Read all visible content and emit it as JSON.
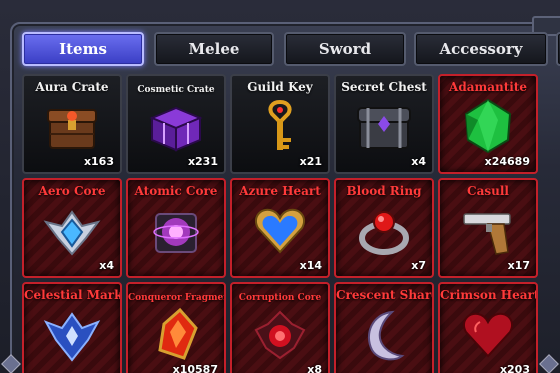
{
  "tabs": [
    {
      "label": "Items",
      "active": true
    },
    {
      "label": "Melee",
      "active": false
    },
    {
      "label": "Sword",
      "active": false
    },
    {
      "label": "Accessory",
      "active": false
    }
  ],
  "items": [
    {
      "name": "Aura Crate",
      "count": "x163",
      "rarity": "common",
      "icon": "aura-crate-icon"
    },
    {
      "name": "Cosmetic Crate",
      "count": "x231",
      "rarity": "common",
      "icon": "cosmetic-crate-icon"
    },
    {
      "name": "Guild Key",
      "count": "x21",
      "rarity": "common",
      "icon": "guild-key-icon"
    },
    {
      "name": "Secret Chest",
      "count": "x4",
      "rarity": "common",
      "icon": "secret-chest-icon"
    },
    {
      "name": "Adamantite",
      "count": "x24689",
      "rarity": "red",
      "icon": "adamantite-icon"
    },
    {
      "name": "Aero Core",
      "count": "x4",
      "rarity": "red",
      "icon": "aero-core-icon"
    },
    {
      "name": "Atomic Core",
      "count": "",
      "rarity": "red",
      "icon": "atomic-core-icon"
    },
    {
      "name": "Azure Heart",
      "count": "x14",
      "rarity": "red",
      "icon": "azure-heart-icon"
    },
    {
      "name": "Blood Ring",
      "count": "x7",
      "rarity": "red",
      "icon": "blood-ring-icon"
    },
    {
      "name": "Casull",
      "count": "x17",
      "rarity": "red",
      "icon": "casull-icon"
    },
    {
      "name": "Celestial Mark",
      "count": "",
      "rarity": "red",
      "icon": "celestial-mark-icon"
    },
    {
      "name": "Conqueror Fragment",
      "count": "x10587",
      "rarity": "red",
      "icon": "conqueror-fragment-icon"
    },
    {
      "name": "Corruption Core",
      "count": "x8",
      "rarity": "red",
      "icon": "corruption-core-icon"
    },
    {
      "name": "Crescent Shard",
      "count": "",
      "rarity": "red",
      "icon": "crescent-shard-icon"
    },
    {
      "name": "Crimson Heart",
      "count": "x203",
      "rarity": "red",
      "icon": "crimson-heart-icon"
    }
  ],
  "colors": {
    "accent": "#5a5ef0",
    "red_border": "#c4202a",
    "red_text": "#ff3a3a"
  }
}
